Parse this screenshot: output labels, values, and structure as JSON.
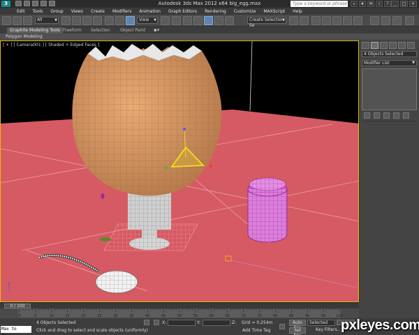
{
  "titlebar": {
    "logo": "3",
    "title": "Autodesk 3ds Max  2012 x64    big_egg.max",
    "search_placeholder": "Type a keyword or phrase",
    "window_buttons": [
      "_",
      "□",
      "×"
    ]
  },
  "menu": {
    "items": [
      "Edit",
      "Tools",
      "Group",
      "Views",
      "Create",
      "Modifiers",
      "Animation",
      "Graph Editors",
      "Rendering",
      "Customize",
      "MAXScript",
      "Help"
    ]
  },
  "toolbar": {
    "selection_filter": "All",
    "reference_coords": "View",
    "named_selection": "Create Selection Se"
  },
  "ribbon": {
    "tabs": [
      "Graphite Modeling Tools",
      "Freeform",
      "Selection",
      "Object Paint"
    ],
    "active_tab": "Graphite Modeling Tools",
    "panel_label": "Polygon Modeling"
  },
  "viewport": {
    "label": "[ + ] [ Camera001 ] [ Shaded + Edged Faces ]",
    "colors": {
      "floor": "#d65a63",
      "background": "#000000",
      "egg": "#d99a66",
      "cup": "#8b1f8b",
      "selection_border": "#e0c000"
    }
  },
  "command_panel": {
    "selected_text": "4 Objects Selected",
    "modifier_list": "Modifier List"
  },
  "timeline": {
    "frame_display": "0 / 100",
    "ticks": [
      "0",
      "5",
      "10",
      "15",
      "20",
      "25",
      "30",
      "35",
      "40",
      "45",
      "50",
      "55",
      "60",
      "65",
      "70",
      "75",
      "80",
      "85",
      "90",
      "95",
      "100"
    ]
  },
  "statusbar": {
    "maxscript": "Max to Physc",
    "selected_status": "4 Objects Selected",
    "prompt": "Click and drag to select and scale objects (uniformly)",
    "x_label": "X:",
    "y_label": "Y:",
    "z_label": "Z:",
    "grid": "Grid = 0.254m",
    "add_time_tag": "Add Time Tag",
    "auto_key": "Auto Key",
    "set_key": "Set Key",
    "selected_option": "Selected",
    "key_filters": "Key Filters..."
  },
  "watermark": "pxleyes.com"
}
